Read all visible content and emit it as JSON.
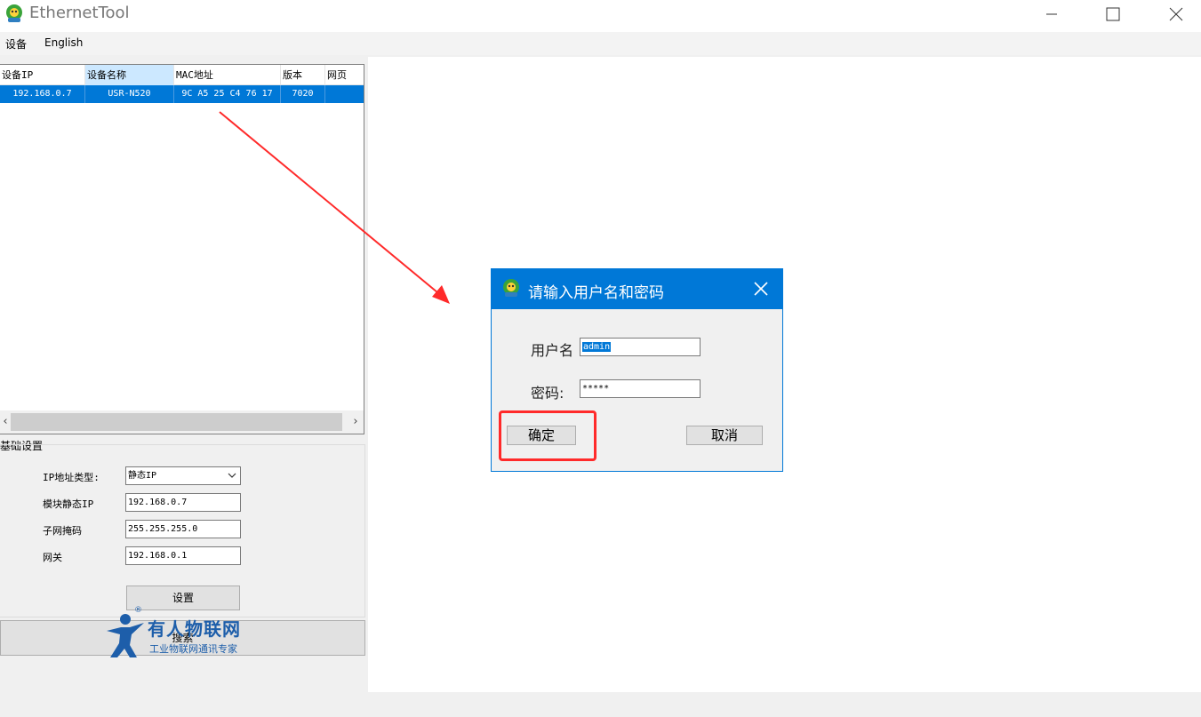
{
  "window": {
    "title": "EthernetTool"
  },
  "menu": {
    "items": [
      "设备",
      "English"
    ]
  },
  "device_table": {
    "columns": [
      "设备IP",
      "设备名称",
      "MAC地址",
      "版本",
      "网页"
    ],
    "rows": [
      {
        "ip": "192.168.0.7",
        "name": "USR-N520",
        "mac": "9C A5 25 C4 76 17",
        "version": "7020",
        "web": ""
      }
    ]
  },
  "basic_settings": {
    "group_label": "基础设置",
    "ip_type_label": "IP地址类型:",
    "ip_type_value": "静态IP",
    "static_ip_label": "模块静态IP",
    "static_ip_value": "192.168.0.7",
    "subnet_label": "子网掩码",
    "subnet_value": "255.255.255.0",
    "gateway_label": "网关",
    "gateway_value": "192.168.0.1",
    "set_button": "设置"
  },
  "search_button": "搜索",
  "logo": {
    "name": "有人物联网",
    "tagline": "工业物联网通讯专家",
    "registered": "®"
  },
  "login_dialog": {
    "title": "请输入用户名和密码",
    "username_label": "用户名",
    "username_value": "admin",
    "password_label": "密码:",
    "password_value": "*****",
    "ok_button": "确定",
    "cancel_button": "取消"
  },
  "colors": {
    "accent": "#0078d7",
    "annotation": "#ff2a2a",
    "logo_blue": "#1d5eaa"
  }
}
